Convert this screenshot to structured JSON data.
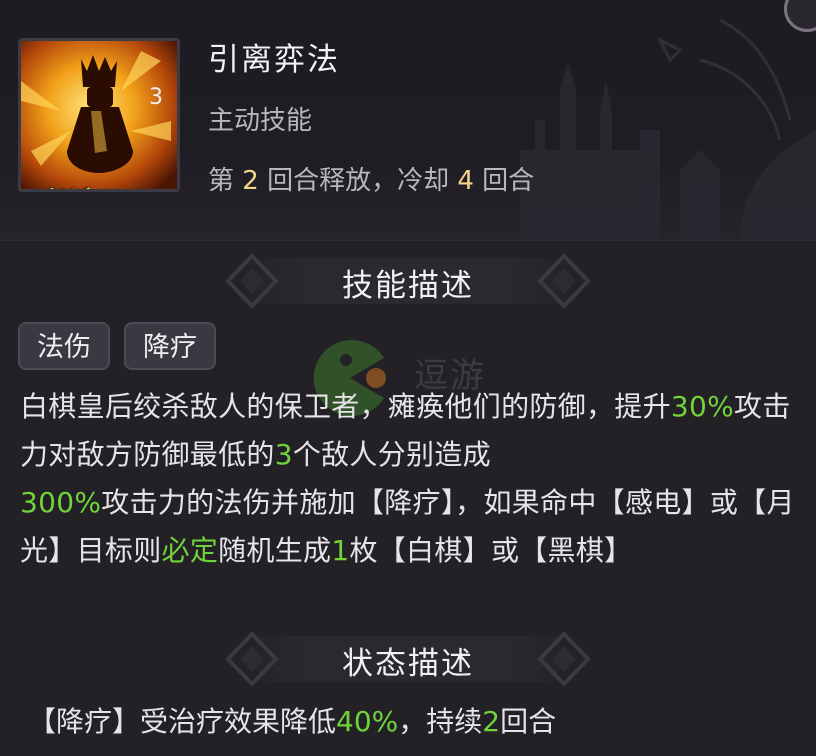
{
  "skill": {
    "level": "3",
    "icon_badge": "必杀",
    "icon": "chess-queen-icon",
    "name": "引离弈法",
    "type": "主动技能",
    "cooldown": {
      "prefix": "第 ",
      "release_round": "2",
      "middle": " 回合释放，冷却 ",
      "cooldown_rounds": "4",
      "suffix": " 回合"
    }
  },
  "sections": {
    "skill_description_title": "技能描述",
    "status_description_title": "状态描述"
  },
  "tags": [
    "法伤",
    "降疗"
  ],
  "description": {
    "p1": "白棋皇后绞杀敌人的保卫者，瘫痪他们的防御，提升",
    "v1": "30%",
    "p2": "攻击力对敌方防御最低的",
    "v2": "3",
    "p3": "个敌人分别造成",
    "v3": "300%",
    "p4": "攻击力的法伤并施加【降疗】，如果命中【感电】或【月光】目标则",
    "v4": "必定",
    "p5": "随机生成",
    "v5": "1",
    "p6": "枚【白棋】或【黑棋】"
  },
  "status": {
    "p1": "【降疗】受治疗效果降低",
    "v1": "40%",
    "p2": "，持续",
    "v2": "2",
    "p3": "回合"
  },
  "watermark": {
    "text": "逗游",
    "icon": "pacman-logo-icon"
  },
  "colors": {
    "highlight_green": "#6fd33a",
    "number_gold": "#f0d48c",
    "background": "#232026"
  }
}
